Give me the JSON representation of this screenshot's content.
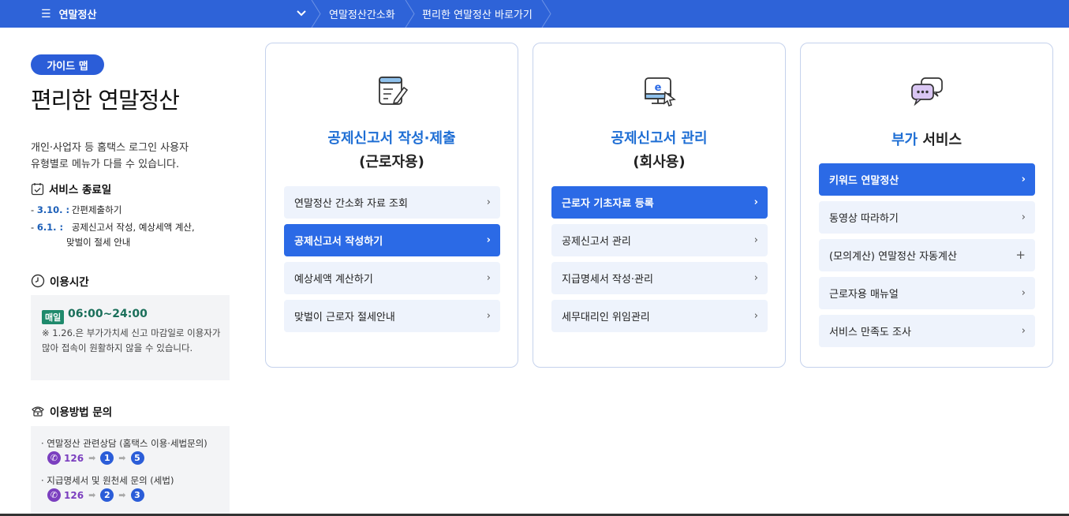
{
  "topbar": {
    "menu_label": "연말정산",
    "crumbs": [
      "연말정산간소화",
      "편리한 연말정산 바로가기"
    ]
  },
  "sidebar": {
    "guide_pill": "가이드 맵",
    "title": "편리한 연말정산",
    "desc_line1": "개인·사업자 등 홈택스 로그인 사용자",
    "desc_line2": "유형별로 메뉴가 다를 수 있습니다.",
    "end_head": "서비스 종료일",
    "end_items": [
      {
        "date": "3.10. :",
        "text": "간편제출하기"
      },
      {
        "date": "6.1. :",
        "text": "공제신고서 작성, 예상세액 계산,",
        "text2": "맞벌이 절세 안내"
      }
    ],
    "time_head": "이용시간",
    "time_badge": "매일",
    "time_value": "06:00~24:00",
    "time_note": "※ 1.26.은 부가가치세 신고 마감일로 이용자가 많아 접속이 원활하지 않을 수 있습니다.",
    "inq_head": "이용방법 문의",
    "inquiries": [
      {
        "label": "· 연말정산 관련상담 (홈택스 이용·세법문의)",
        "phone": "126",
        "steps": [
          "1",
          "5"
        ]
      },
      {
        "label": "· 지급명세서 및 원천세 문의 (세법)",
        "phone": "126",
        "steps": [
          "2",
          "3"
        ]
      }
    ]
  },
  "cards": [
    {
      "title_line1": "공제신고서 작성·제출",
      "title_line2": "(근로자용)",
      "icon": "document-edit-icon",
      "items": [
        {
          "label": "연말정산 간소화 자료 조회",
          "active": false
        },
        {
          "label": "공제신고서 작성하기",
          "active": true
        },
        {
          "label": "예상세액 계산하기",
          "active": false
        },
        {
          "label": "맞벌이 근로자 절세안내",
          "active": false
        }
      ]
    },
    {
      "title_line1": "공제신고서 관리",
      "title_line2": "(회사용)",
      "icon": "monitor-e-icon",
      "items": [
        {
          "label": "근로자 기초자료 등록",
          "active": true
        },
        {
          "label": "공제신고서 관리",
          "active": false
        },
        {
          "label": "지급명세서 작성·관리",
          "active": false
        },
        {
          "label": "세무대리인 위임관리",
          "active": false
        }
      ]
    },
    {
      "title_blue": "부가",
      "title_dark": " 서비스",
      "icon": "chat-bubbles-icon",
      "items": [
        {
          "label": "키워드 연말정산",
          "active": true,
          "mark": "›"
        },
        {
          "label": "동영상 따라하기",
          "active": false,
          "mark": "›"
        },
        {
          "label": "(모의계산) 연말정산 자동계산",
          "active": false,
          "mark": "+"
        },
        {
          "label": "근로자용 매뉴얼",
          "active": false,
          "mark": "›"
        },
        {
          "label": "서비스 만족도 조사",
          "active": false,
          "mark": "›"
        }
      ]
    }
  ],
  "colors": {
    "accent": "#2b6ae6",
    "topbar": "#2e63d8",
    "title_blue": "#1e6ed4"
  }
}
